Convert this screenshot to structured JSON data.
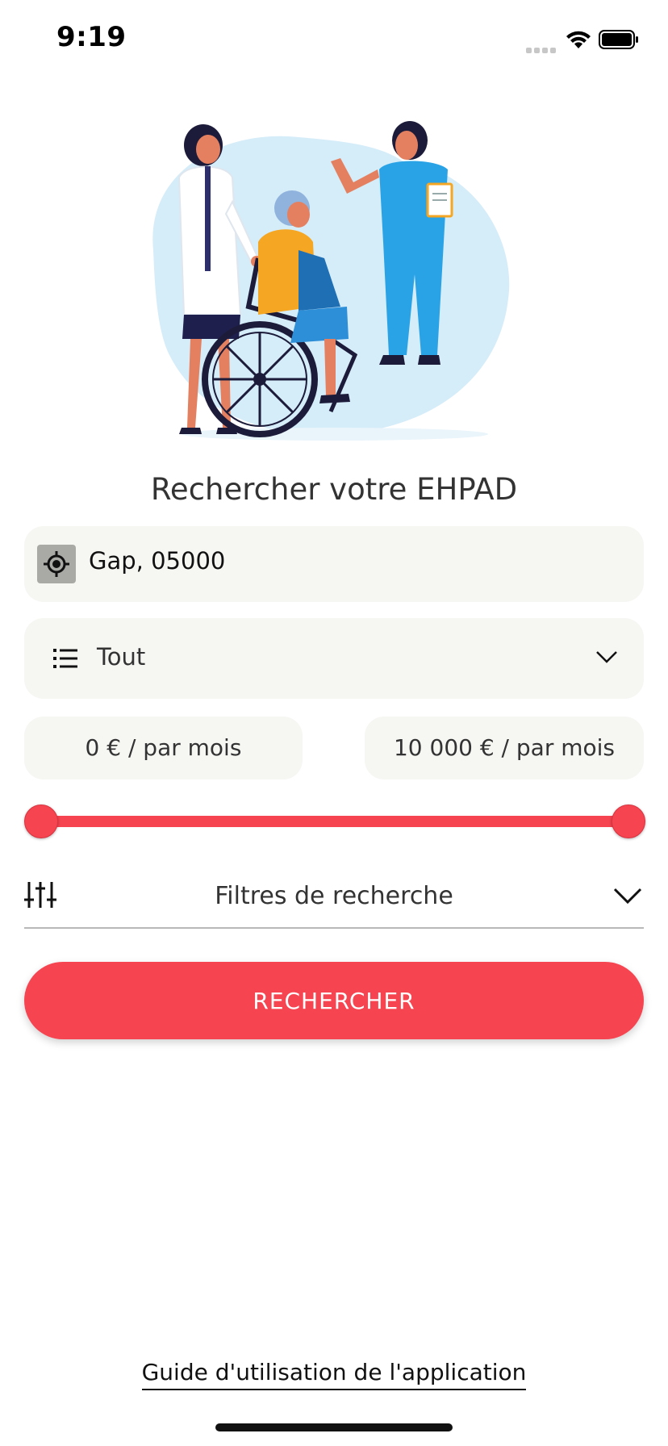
{
  "status_bar": {
    "time": "9:19"
  },
  "title": "Rechercher votre EHPAD",
  "location": {
    "value": "Gap, 05000",
    "icon": "locate-icon"
  },
  "category": {
    "value": "Tout",
    "icon": "list-icon"
  },
  "price": {
    "min_label": "0 € / par mois",
    "max_label": "10 000 € / par mois",
    "range_min_fraction": 0,
    "range_max_fraction": 1
  },
  "filters": {
    "label": "Filtres de recherche"
  },
  "search_button": {
    "label": "RECHERCHER"
  },
  "guide_link": "Guide d'utilisation de l'application",
  "colors": {
    "accent": "#f64450",
    "field_bg": "#f6f6f3"
  }
}
